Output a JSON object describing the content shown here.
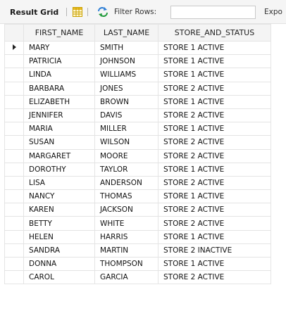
{
  "toolbar": {
    "result_grid_label": "Result Grid",
    "filter_label": "Filter Rows:",
    "filter_value": "",
    "export_label": "Expo"
  },
  "columns": [
    "FIRST_NAME",
    "LAST_NAME",
    "STORE_AND_STATUS"
  ],
  "rows": [
    [
      "MARY",
      "SMITH",
      "STORE 1 ACTIVE"
    ],
    [
      "PATRICIA",
      "JOHNSON",
      "STORE 1 ACTIVE"
    ],
    [
      "LINDA",
      "WILLIAMS",
      "STORE 1 ACTIVE"
    ],
    [
      "BARBARA",
      "JONES",
      "STORE 2 ACTIVE"
    ],
    [
      "ELIZABETH",
      "BROWN",
      "STORE 1 ACTIVE"
    ],
    [
      "JENNIFER",
      "DAVIS",
      "STORE 2 ACTIVE"
    ],
    [
      "MARIA",
      "MILLER",
      "STORE 1 ACTIVE"
    ],
    [
      "SUSAN",
      "WILSON",
      "STORE 2 ACTIVE"
    ],
    [
      "MARGARET",
      "MOORE",
      "STORE 2 ACTIVE"
    ],
    [
      "DOROTHY",
      "TAYLOR",
      "STORE 1 ACTIVE"
    ],
    [
      "LISA",
      "ANDERSON",
      "STORE 2 ACTIVE"
    ],
    [
      "NANCY",
      "THOMAS",
      "STORE 1 ACTIVE"
    ],
    [
      "KAREN",
      "JACKSON",
      "STORE 2 ACTIVE"
    ],
    [
      "BETTY",
      "WHITE",
      "STORE 2 ACTIVE"
    ],
    [
      "HELEN",
      "HARRIS",
      "STORE 1 ACTIVE"
    ],
    [
      "SANDRA",
      "MARTIN",
      "STORE 2 INACTIVE"
    ],
    [
      "DONNA",
      "THOMPSON",
      "STORE 1 ACTIVE"
    ],
    [
      "CAROL",
      "GARCIA",
      "STORE 2 ACTIVE"
    ]
  ],
  "selected_row": 0,
  "icons": {
    "grid": "grid-view-icon",
    "refresh": "refresh-icon",
    "row_marker": "current-row-marker-icon"
  },
  "colors": {
    "grid_icon_yellow": "#e8b923",
    "refresh_blue": "#2f7fd6"
  }
}
